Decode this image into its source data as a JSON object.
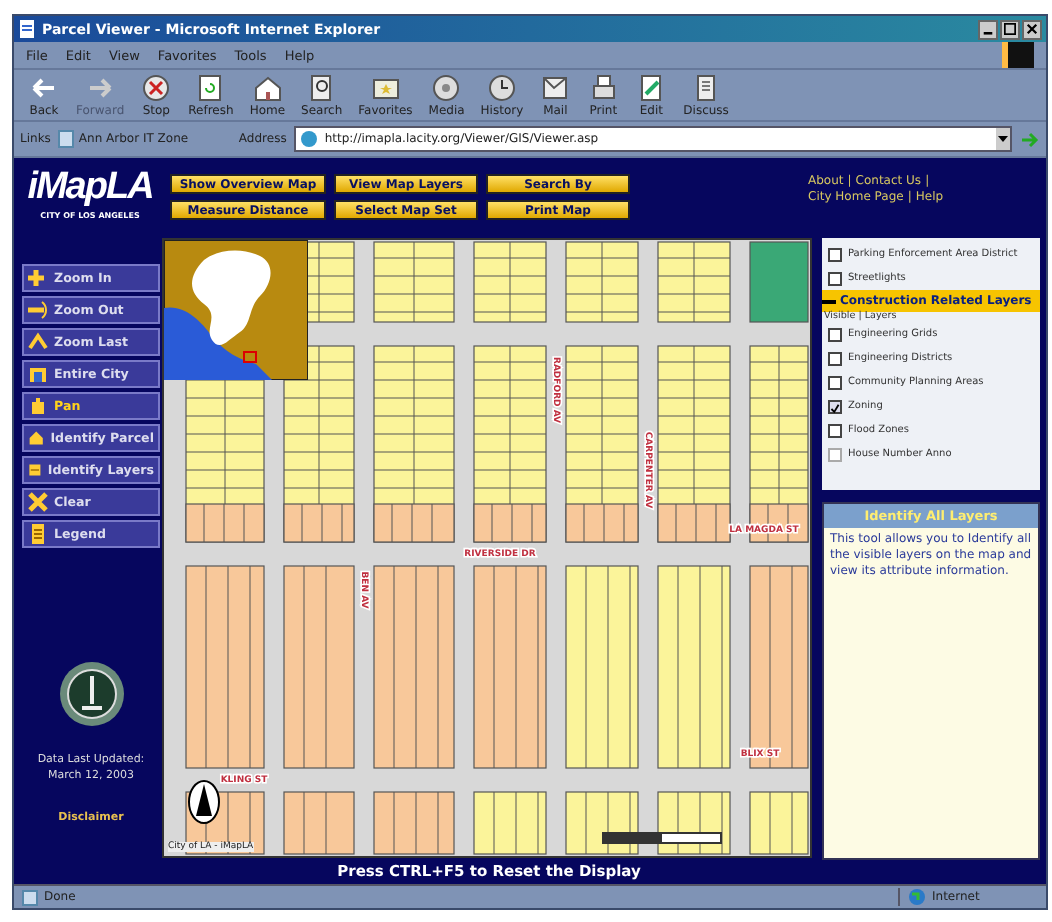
{
  "window": {
    "title": "Parcel Viewer - Microsoft Internet Explorer"
  },
  "menu": [
    "File",
    "Edit",
    "View",
    "Favorites",
    "Tools",
    "Help"
  ],
  "toolbar": [
    {
      "label": "Back",
      "kind": "back",
      "disabled": false
    },
    {
      "label": "Forward",
      "kind": "forward",
      "disabled": true
    },
    {
      "label": "Stop",
      "kind": "stop",
      "disabled": false
    },
    {
      "label": "Refresh",
      "kind": "refresh",
      "disabled": false
    },
    {
      "label": "Home",
      "kind": "home",
      "disabled": false
    },
    {
      "label": "Search",
      "kind": "search",
      "disabled": false
    },
    {
      "label": "Favorites",
      "kind": "favorites",
      "disabled": false
    },
    {
      "label": "Media",
      "kind": "media",
      "disabled": false
    },
    {
      "label": "History",
      "kind": "history",
      "disabled": false
    },
    {
      "label": "Mail",
      "kind": "mail",
      "disabled": false
    },
    {
      "label": "Print",
      "kind": "print",
      "disabled": false
    },
    {
      "label": "Edit",
      "kind": "edit",
      "disabled": false
    },
    {
      "label": "Discuss",
      "kind": "discuss",
      "disabled": false
    }
  ],
  "links_bar": {
    "label": "Links",
    "item": "Ann Arbor IT Zone"
  },
  "address": {
    "label": "Address",
    "value": "http://imapla.lacity.org/Viewer/GIS/Viewer.asp"
  },
  "header": {
    "logo": "iMapLA",
    "logo_sub": "CITY OF LOS ANGELES",
    "buttons": [
      "Show Overview Map",
      "View Map Layers",
      "Search By",
      "Measure Distance",
      "Select Map Set",
      "Print Map"
    ],
    "links": [
      [
        "About",
        "Contact Us"
      ],
      [
        "City Home Page",
        "Help"
      ]
    ],
    "separator": "|"
  },
  "tools": [
    {
      "label": "Zoom In",
      "kind": "zoomin",
      "selected": false
    },
    {
      "label": "Zoom Out",
      "kind": "zoomout",
      "selected": false
    },
    {
      "label": "Zoom Last",
      "kind": "zoomlast",
      "selected": false
    },
    {
      "label": "Entire City",
      "kind": "city",
      "selected": false
    },
    {
      "label": "Pan",
      "kind": "pan",
      "selected": true
    },
    {
      "label": "Identify Parcel",
      "kind": "parcel",
      "selected": false
    },
    {
      "label": "Identify Layers",
      "kind": "layers",
      "selected": false
    },
    {
      "label": "Clear",
      "kind": "clear",
      "selected": false
    },
    {
      "label": "Legend",
      "kind": "legend",
      "selected": false
    }
  ],
  "updated": {
    "label": "Data Last Updated:",
    "date": "March 12, 2003",
    "disclaimer": "Disclaimer"
  },
  "map": {
    "street_labels": [
      "RADFORD AV",
      "CARPENTER AV",
      "LA MAGDA ST",
      "RIVERSIDE DR",
      "BEN AV",
      "BLIX ST",
      "KLING ST"
    ],
    "credit": "City of LA - iMapLA",
    "reset_hint": "Press CTRL+F5 to Reset the Display"
  },
  "layers": {
    "items": [
      {
        "label": "Parking Enforcement Area District",
        "checked": false,
        "disabled": false
      },
      {
        "label": "Streetlights",
        "checked": false,
        "disabled": false
      }
    ],
    "group": {
      "title": "Construction Related Layers",
      "columns": "Visible | Layers",
      "items": [
        {
          "label": "Engineering Grids",
          "checked": false,
          "disabled": false
        },
        {
          "label": "Engineering Districts",
          "checked": false,
          "disabled": false
        },
        {
          "label": "Community Planning Areas",
          "checked": false,
          "disabled": false
        },
        {
          "label": "Zoning",
          "checked": true,
          "disabled": false
        },
        {
          "label": "Flood Zones",
          "checked": false,
          "disabled": false
        },
        {
          "label": "House Number Anno",
          "checked": false,
          "disabled": true
        }
      ]
    }
  },
  "info": {
    "title": "Identify All Layers",
    "text": "This tool allows you to Identify all the visible layers on the map and view its attribute information."
  },
  "status_bar": {
    "text": "Done",
    "zone": "Internet"
  }
}
